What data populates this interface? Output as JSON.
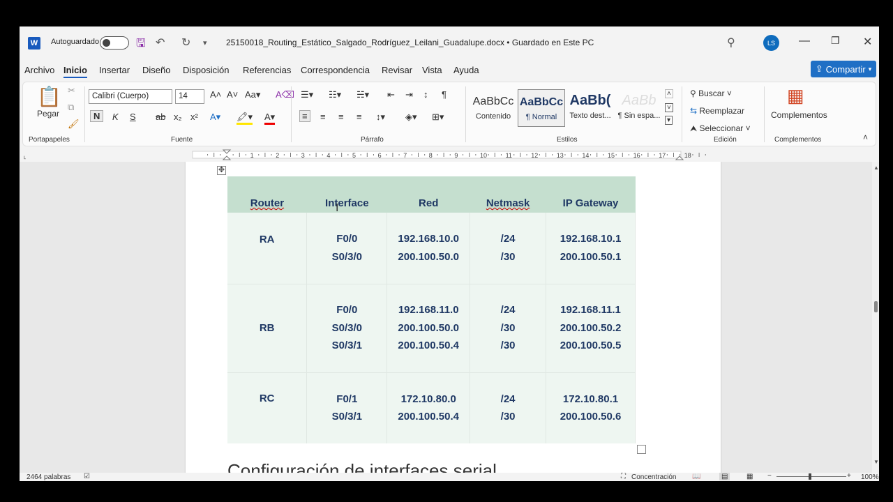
{
  "titlebar": {
    "app_icon": "word-icon",
    "autosave_label": "Autoguardado",
    "doc_title": "25150018_Routing_Estático_Salgado_Rodríguez_Leilani_Guadalupe.docx • Guardado en Este PC",
    "user_initials": "LS"
  },
  "menu": [
    "Archivo",
    "Inicio",
    "Insertar",
    "Diseño",
    "Disposición",
    "Referencias",
    "Correspondencia",
    "Revisar",
    "Vista",
    "Ayuda"
  ],
  "share_label": "Compartir",
  "ribbon": {
    "paste_label": "Pegar",
    "font_name": "Calibri (Cuerpo)",
    "font_size": "14",
    "groups": [
      "Portapapeles",
      "Fuente",
      "Párrafo",
      "Estilos",
      "Edición",
      "Complementos"
    ],
    "styles": [
      {
        "preview": "AaBbCc",
        "name": "Contenido"
      },
      {
        "preview": "AaBbCc",
        "name": "¶ Normal"
      },
      {
        "preview": "AaBb(",
        "name": "Texto dest..."
      },
      {
        "preview": "AaBb",
        "name": "¶ Sin espa..."
      }
    ],
    "find_label": "Buscar",
    "replace_label": "Reemplazar",
    "select_label": "Seleccionar",
    "addins_label": "Complementos",
    "bold_glyph": "N",
    "italic_glyph": "K",
    "underline_glyph": "S"
  },
  "table": {
    "headers": [
      "Router",
      "Interface",
      "Red",
      "Netmask",
      "IP Gateway"
    ],
    "rows": [
      {
        "router": "RA",
        "interface": [
          "F0/0",
          "S0/3/0"
        ],
        "red": [
          "192.168.10.0",
          "200.100.50.0"
        ],
        "netmask": [
          "/24",
          "/30"
        ],
        "gateway": [
          "192.168.10.1",
          "200.100.50.1"
        ]
      },
      {
        "router": "RB",
        "interface": [
          "F0/0",
          "S0/3/0",
          "S0/3/1"
        ],
        "red": [
          "192.168.11.0",
          "200.100.50.0",
          "200.100.50.4"
        ],
        "netmask": [
          "/24",
          "/30",
          "/30"
        ],
        "gateway": [
          "192.168.11.1",
          "200.100.50.2",
          "200.100.50.5"
        ]
      },
      {
        "router": "RC",
        "interface": [
          "F0/1",
          "S0/3/1"
        ],
        "red": [
          "172.10.80.0",
          "200.100.50.4"
        ],
        "netmask": [
          "/24",
          "/30"
        ],
        "gateway": [
          "172.10.80.1",
          "200.100.50.6"
        ]
      }
    ]
  },
  "next_heading": "Configuración de interfaces serial",
  "status": {
    "words": "2464 palabras",
    "focus": "Concentración",
    "zoom": "100%"
  },
  "colors": {
    "accent": "#185abd",
    "table_header": "#c5dfcf",
    "table_body": "#eef6f1",
    "table_text": "#1f3864"
  }
}
